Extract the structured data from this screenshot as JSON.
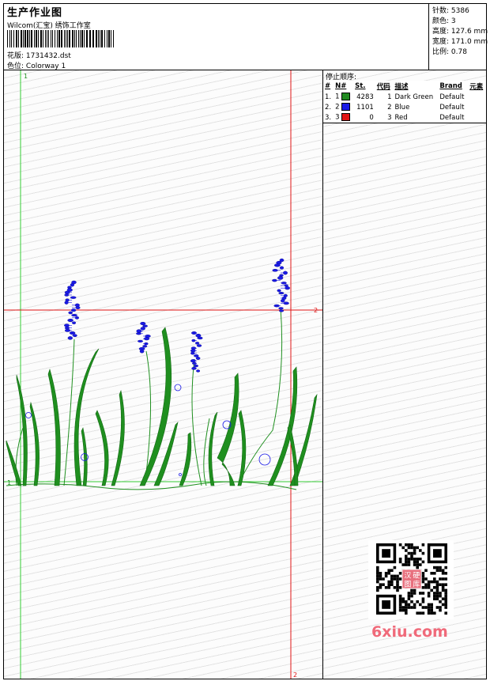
{
  "header": {
    "title": "生产作业图",
    "company": "Wilcom(汇宝) 绣饰工作室",
    "file_label": "花版:",
    "file_name": "1731432.dst",
    "colorway_label": "色位:",
    "colorway_name": "Colorway 1"
  },
  "stats": [
    {
      "label": "针数:",
      "value": "5386"
    },
    {
      "label": "颜色:",
      "value": "3"
    },
    {
      "label": "高度:",
      "value": "127.6 mm"
    },
    {
      "label": "宽度:",
      "value": "171.0 mm"
    },
    {
      "label": "比例:",
      "value": "0.78"
    }
  ],
  "stop_sequence": {
    "title": "停止顺序:",
    "columns": [
      "#",
      "N#",
      "St.",
      "代码",
      "描述",
      "Brand",
      "元素"
    ],
    "rows": [
      {
        "idx": "1.",
        "n": "1",
        "color": "#228b22",
        "stitches": "4283",
        "code": "1",
        "desc": "Dark Green",
        "brand": "Default"
      },
      {
        "idx": "2.",
        "n": "2",
        "color": "#1a1ae6",
        "stitches": "1101",
        "code": "2",
        "desc": "Blue",
        "brand": "Default"
      },
      {
        "idx": "3.",
        "n": "3",
        "color": "#e01414",
        "stitches": "0",
        "code": "3",
        "desc": "Red",
        "brand": "Default"
      }
    ]
  },
  "guides": {
    "v1_label": "1",
    "h1_label": "1",
    "h2_label": "2",
    "v2_label": "2"
  },
  "colors": {
    "green_thread": "#1f8f1f",
    "blue_thread": "#1a1ae6",
    "green_guide": "#33cc33",
    "red_guide": "#e01414"
  },
  "watermark": {
    "text": "6xiu.com",
    "stamp": "汉硬图库"
  }
}
